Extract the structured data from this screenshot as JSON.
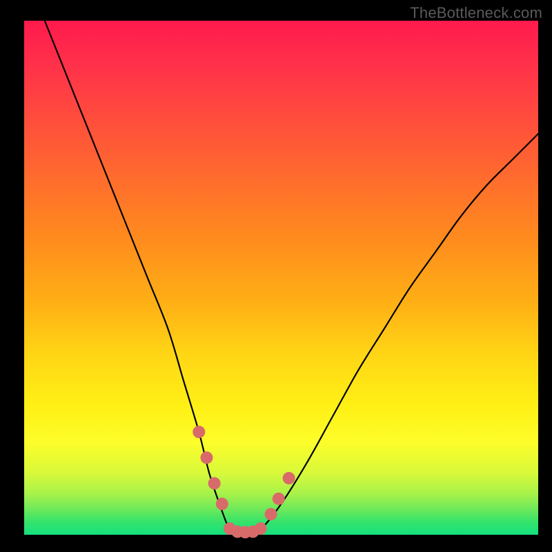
{
  "watermark": "TheBottleneck.com",
  "chart_data": {
    "type": "line",
    "title": "",
    "xlabel": "",
    "ylabel": "",
    "xlim": [
      0,
      100
    ],
    "ylim": [
      0,
      100
    ],
    "series": [
      {
        "name": "bottleneck-curve",
        "x": [
          4,
          8,
          12,
          16,
          20,
          24,
          28,
          31,
          34,
          36,
          38,
          40,
          42,
          44,
          46,
          50,
          55,
          60,
          65,
          70,
          75,
          80,
          85,
          90,
          95,
          100
        ],
        "y": [
          100,
          90,
          80,
          70,
          60,
          50,
          40,
          30,
          20,
          12,
          6,
          1,
          0,
          0,
          1,
          6,
          14,
          23,
          32,
          40,
          48,
          55,
          62,
          68,
          73,
          78
        ]
      },
      {
        "name": "highlight-dots-left",
        "x": [
          34,
          35.5,
          37,
          38.5
        ],
        "y": [
          20,
          15,
          10,
          6
        ]
      },
      {
        "name": "highlight-dots-bottom",
        "x": [
          40,
          41.5,
          43,
          44.5,
          46
        ],
        "y": [
          1.2,
          0.6,
          0.5,
          0.6,
          1.2
        ]
      },
      {
        "name": "highlight-dots-right",
        "x": [
          48,
          49.5,
          51.5
        ],
        "y": [
          4,
          7,
          11
        ]
      }
    ],
    "gradient_stops": [
      {
        "pos": 0,
        "color": "#ff1a4d"
      },
      {
        "pos": 0.55,
        "color": "#ffd615"
      },
      {
        "pos": 0.82,
        "color": "#fdfd2a"
      },
      {
        "pos": 1.0,
        "color": "#15e080"
      }
    ],
    "curve_color": "#000000",
    "dot_color": "#d96a6a"
  }
}
